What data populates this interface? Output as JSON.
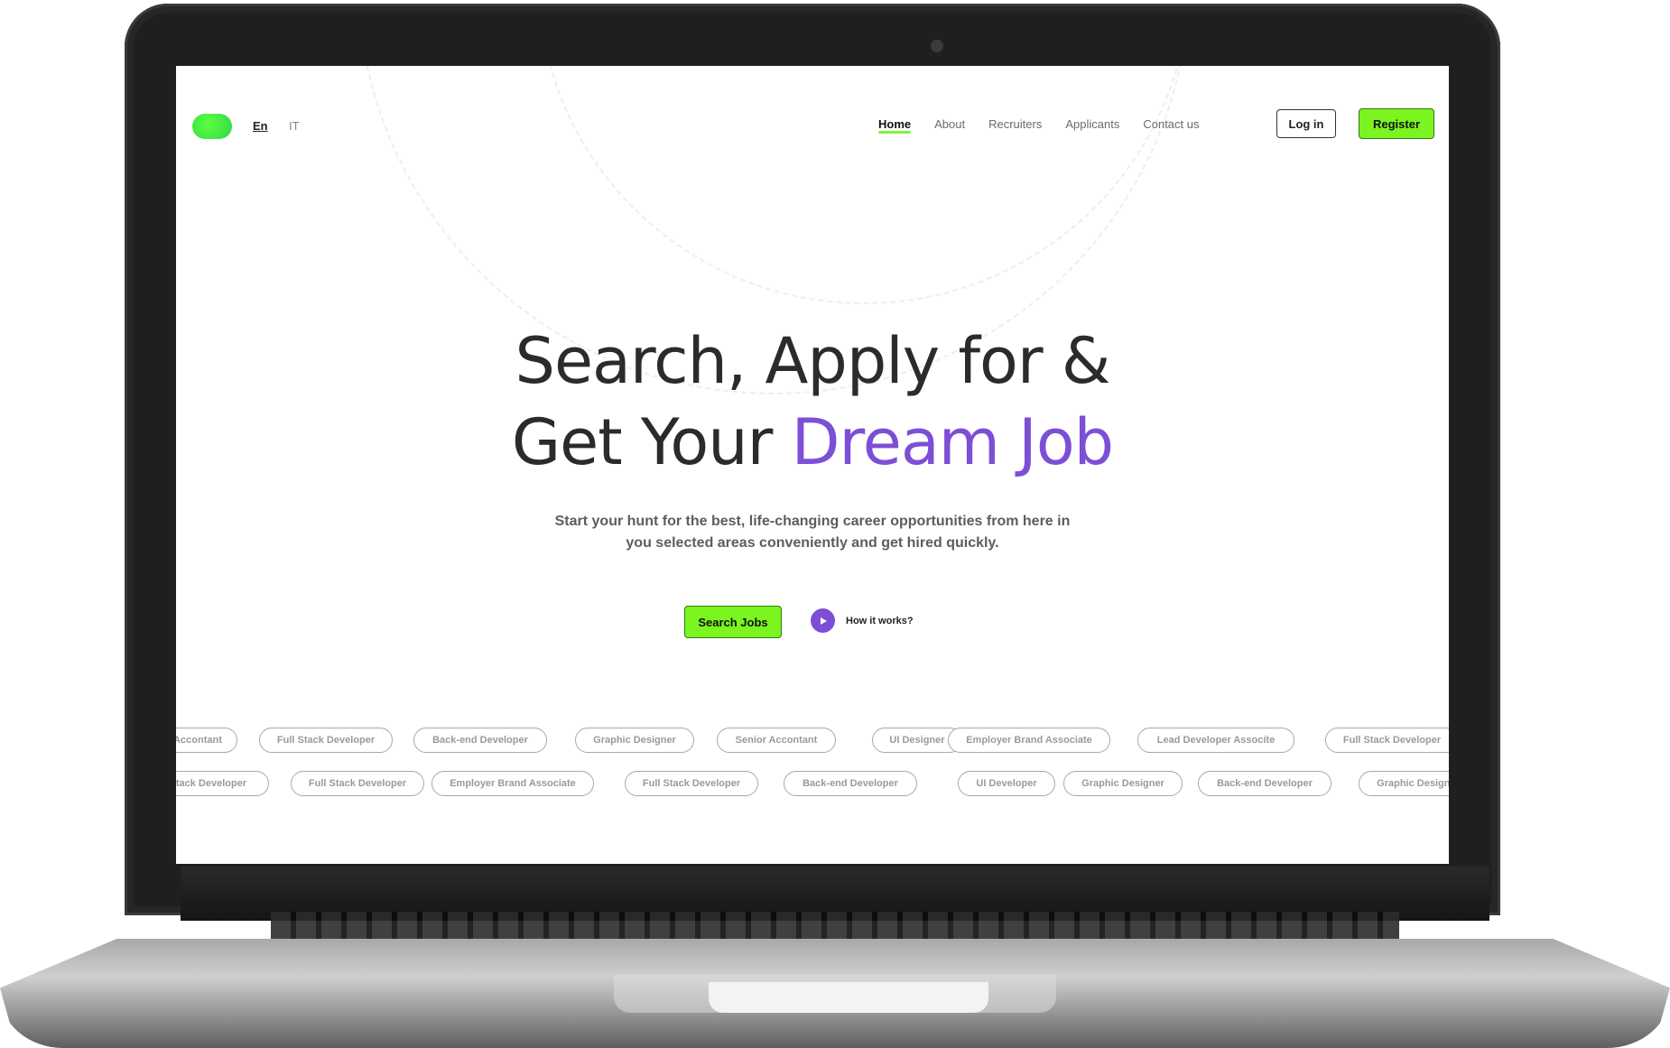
{
  "header": {
    "languages": [
      {
        "label": "En",
        "active": true
      },
      {
        "label": "IT",
        "active": false
      }
    ],
    "nav": [
      {
        "label": "Home",
        "active": true
      },
      {
        "label": "About",
        "active": false
      },
      {
        "label": "Recruiters",
        "active": false
      },
      {
        "label": "Applicants",
        "active": false
      },
      {
        "label": "Contact us",
        "active": false
      }
    ],
    "login_label": "Log in",
    "register_label": "Register"
  },
  "hero": {
    "title_line1": "Search, Apply for &",
    "title_line2_plain": "Get Your ",
    "title_line2_accent": "Dream Job",
    "subtitle_line1": "Start your hunt for the best, life-changing career opportunities from here in",
    "subtitle_line2": "you selected areas conveniently and get hired quickly.",
    "search_button": "Search Jobs",
    "how_it_works": "How it works?"
  },
  "tags": {
    "row1": [
      "Accontant",
      "Full Stack Developer",
      "Back-end Developer",
      "Graphic Designer",
      "Senior Accontant",
      "UI Designer",
      "Employer  Brand Associate",
      "Lead Developer Associte",
      "Full Stack Developer"
    ],
    "row2": [
      "Full Stack Developer",
      "Full Stack Developer",
      "Employer Brand Associate",
      "Full Stack Developer",
      "Back-end Developer",
      "UI Developer",
      "Graphic Designer",
      "Back-end Developer",
      "Graphic Designer"
    ]
  },
  "colors": {
    "accent_green": "#7bf41f",
    "accent_purple": "#7c4fd6",
    "text_dark": "#2b2b2b"
  }
}
